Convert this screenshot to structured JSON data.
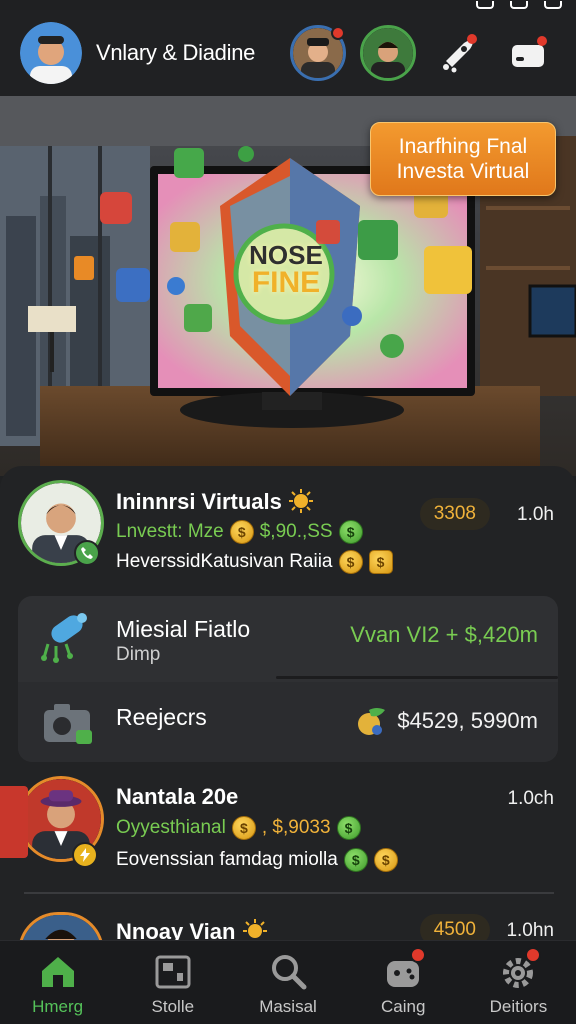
{
  "header": {
    "title": "Vnlary & Diadine",
    "profile_avatar": "user-avatar",
    "friend_avatars": [
      "friend-avatar-1",
      "friend-avatar-2"
    ],
    "actions": [
      "rocket-icon",
      "notification-icon"
    ]
  },
  "hero": {
    "screen_text_line1": "NOSE",
    "screen_text_line2": "FINE",
    "banner_line1": "Inarfhing Fnal",
    "banner_line2": "Investa Virtual"
  },
  "posts": [
    {
      "name": "Ininnrsi Virtuals",
      "line1_prefix": "Lnvestt: Mze",
      "line1_amount": "$,90.,SS",
      "line2": "HeverssidKatusivan Raiia",
      "score": "3308",
      "time": "1.0h"
    },
    {
      "name": "Nantala 20e",
      "line1_prefix": "Oyyesthianal",
      "line1_amount": ", $,9033",
      "line2": "Eovenssian famdag miolla",
      "time": "1.0ch"
    },
    {
      "name": "Nnoay Vian",
      "score": "4500",
      "time": "1.0hn"
    }
  ],
  "stats": {
    "row1_title": "Miesial Fiatlo",
    "row1_sub": "Dimp",
    "row1_value": "Vvan VI2 + $,420m",
    "row2_title": "Reejecrs",
    "row2_value": "$4529, 5990m"
  },
  "nav": [
    {
      "label": "Hmerg",
      "icon": "home-icon"
    },
    {
      "label": "Stolle",
      "icon": "store-icon"
    },
    {
      "label": "Masisal",
      "icon": "search-icon"
    },
    {
      "label": "Caing",
      "icon": "gamepad-icon"
    },
    {
      "label": "Deitiors",
      "icon": "gear-icon"
    }
  ],
  "colors": {
    "accent_green": "#55c25a",
    "gain_green": "#79cc52",
    "gold": "#f0b23a",
    "badge_red": "#e0392b",
    "banner_orange": "#f39a2f"
  }
}
